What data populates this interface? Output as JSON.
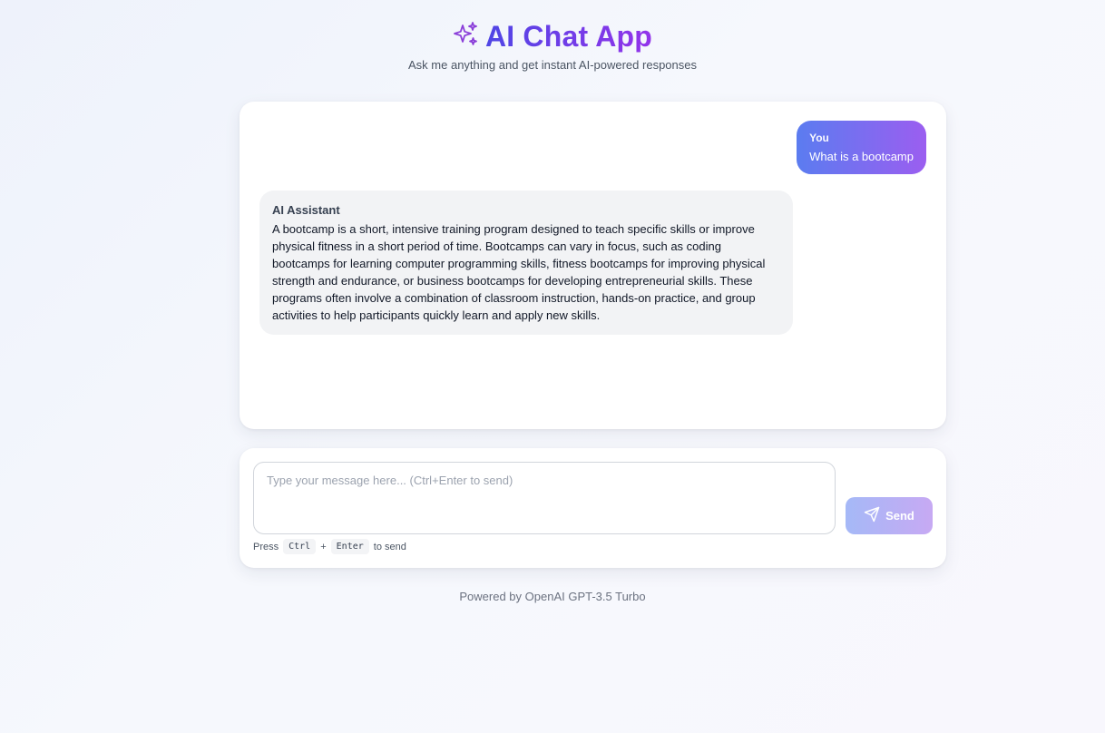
{
  "header": {
    "icon": "sparkles-icon",
    "title": "AI Chat App",
    "subtitle": "Ask me anything and get instant AI-powered responses"
  },
  "messages": [
    {
      "role": "user",
      "sender": "You",
      "text": "What is a bootcamp"
    },
    {
      "role": "assistant",
      "sender": "AI Assistant",
      "text": "A bootcamp is a short, intensive training program designed to teach specific skills or improve physical fitness in a short period of time. Bootcamps can vary in focus, such as coding bootcamps for learning computer programming skills, fitness bootcamps for improving physical strength and endurance, or business bootcamps for developing entrepreneurial skills. These programs often involve a combination of classroom instruction, hands-on practice, and group activities to help participants quickly learn and apply new skills."
    }
  ],
  "composer": {
    "value": "",
    "placeholder": "Type your message here... (Ctrl+Enter to send)",
    "send_label": "Send",
    "send_icon": "send-icon",
    "hint_prefix": "Press",
    "hint_key1": "Ctrl",
    "hint_plus": "+",
    "hint_key2": "Enter",
    "hint_suffix": "to send"
  },
  "footer": {
    "text": "Powered by OpenAI GPT-3.5 Turbo"
  },
  "colors": {
    "accent_start": "#4f46e5",
    "accent_end": "#9333ea",
    "user_bubble_start": "#5b7cf0",
    "user_bubble_end": "#9b5ef0",
    "assistant_bubble": "#f2f3f5"
  }
}
